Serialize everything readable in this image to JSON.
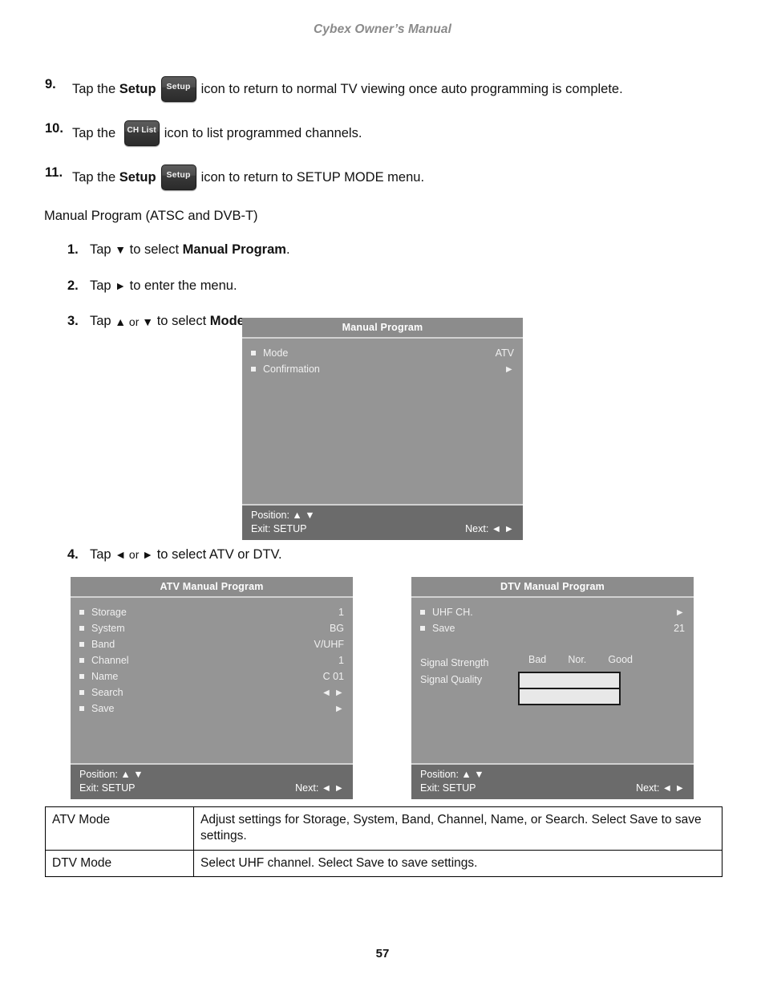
{
  "header": {
    "running_title": "Cybex Owner’s Manual"
  },
  "steps_top": [
    {
      "num": "9.",
      "pre": "Tap the ",
      "bold": "Setup",
      "icon": "Setup",
      "post": "icon to return to normal TV viewing once auto programming is complete."
    },
    {
      "num": "10.",
      "pre": "Tap the ",
      "bold": "",
      "icon": "CH List",
      "post": "icon to list programmed channels."
    },
    {
      "num": "11.",
      "pre": "Tap the ",
      "bold": "Setup",
      "icon": "Setup",
      "post": "icon to return to SETUP MODE menu."
    }
  ],
  "section": {
    "caption": "Manual Program (ATSC and DVB-T)"
  },
  "substeps": [
    {
      "num": "1.",
      "pre": "Tap ",
      "glyph": "▼",
      "mid": " to select ",
      "bold": "Manual Program",
      "post": "."
    },
    {
      "num": "2.",
      "pre": "Tap ",
      "glyph": "►",
      "mid": " to enter the menu.",
      "bold": "",
      "post": ""
    },
    {
      "num": "3.",
      "pre": "Tap ",
      "glyph": "▲ or ▼",
      "mid": " to select ",
      "bold": "Mode",
      "post": "."
    },
    {
      "num": "4.",
      "pre": "Tap ",
      "glyph": "◄ or ►",
      "mid": " to select ATV or DTV.",
      "bold": "",
      "post": ""
    }
  ],
  "osd_manual": {
    "title": "Manual Program",
    "rows": [
      {
        "label": "Mode",
        "value": "ATV"
      },
      {
        "label": "Confirmation",
        "value": "►"
      }
    ],
    "footer": {
      "position": "Position: ▲ ▼",
      "exit": "Exit: SETUP",
      "next": "Next: ◄ ►"
    }
  },
  "osd_atv": {
    "title": "ATV Manual Program",
    "rows": [
      {
        "label": "Storage",
        "value": "1"
      },
      {
        "label": "System",
        "value": "BG"
      },
      {
        "label": "Band",
        "value": "V/UHF"
      },
      {
        "label": "Channel",
        "value": "1"
      },
      {
        "label": "Name",
        "value": "C 01"
      },
      {
        "label": "Search",
        "value": "◄ ►"
      },
      {
        "label": "Save",
        "value": "►"
      }
    ],
    "footer": {
      "position": "Position: ▲ ▼",
      "exit": "Exit: SETUP",
      "next": "Next: ◄ ►"
    }
  },
  "osd_dtv": {
    "title": "DTV Manual Program",
    "rows": [
      {
        "label": "UHF CH.",
        "value": "►"
      },
      {
        "label": "Save",
        "value": "21"
      }
    ],
    "signal": {
      "scale_bad": "Bad",
      "scale_nor": "Nor.",
      "scale_good": "Good",
      "strength_label": "Signal Strength",
      "quality_label": "Signal Quality"
    },
    "footer": {
      "position": "Position: ▲ ▼",
      "exit": "Exit: SETUP",
      "next": "Next: ◄ ►"
    }
  },
  "desc_table": {
    "rows": [
      {
        "key": "ATV Mode",
        "desc": "Adjust settings for Storage, System, Band, Channel, Name, or Search. Select Save to save settings."
      },
      {
        "key": "DTV Mode",
        "desc": "Select UHF channel. Select Save to save settings."
      }
    ]
  },
  "footer": {
    "page_number": "57"
  }
}
